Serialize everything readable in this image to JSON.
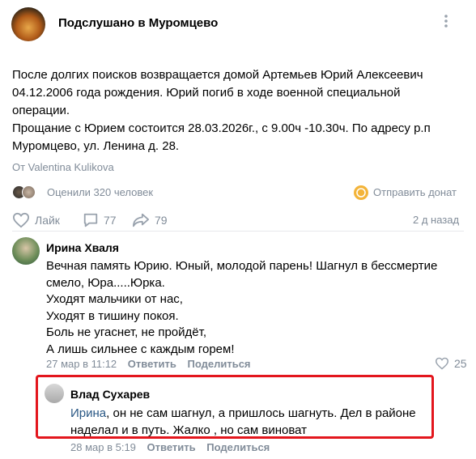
{
  "group": {
    "name": "Подслушано в Муромцево"
  },
  "post": {
    "lines": [
      "После долгих поисков возвращается домой Артемьев Юрий Алексеевич",
      "04.12.2006 года рождения. Юрий погиб в ходе военной специальной",
      "операции.",
      "Прощание с Юрием состоится 28.03.2026г., с 9.00ч -10.30ч. По адресу р.п",
      "Муромцево, ул. Ленина д. 28."
    ],
    "author": "От Valentina Kulikova",
    "rating": "Оценили 320 человек",
    "donate": "Отправить донат",
    "like_label": "Лайк",
    "comments_count": "77",
    "shares_count": "79",
    "time": "2 д назад"
  },
  "comments": [
    {
      "name": "Ирина Хваля",
      "lines": [
        "Вечная память Юрию. Юный, молодой парень! Шагнул в бессмертие",
        "смело, Юра.....Юрка.",
        "Уходят мальчики от нас,",
        "Уходят в тишину покоя.",
        "Боль не угаснет, не пройдёт,",
        "А лишь сильнее с каждым горем!"
      ],
      "date": "27 мар в 11:12",
      "reply_label": "Ответить",
      "share_label": "Поделиться",
      "likes": "25"
    },
    {
      "name": "Влад Сухарев",
      "mention": "Ирина",
      "line1_rest": ", он не сам шагнул, а пришлось шагнуть. Дел в районе",
      "line2": "наделал и в путь. Жалко , но сам виноват",
      "date": "28 мар в 5:19",
      "reply_label": "Ответить",
      "share_label": "Поделиться"
    }
  ],
  "colors": {
    "accent_text": "#2a5885",
    "muted": "#818c99",
    "highlight_border": "#e3161d",
    "donate_coin": "#f3b43a"
  }
}
